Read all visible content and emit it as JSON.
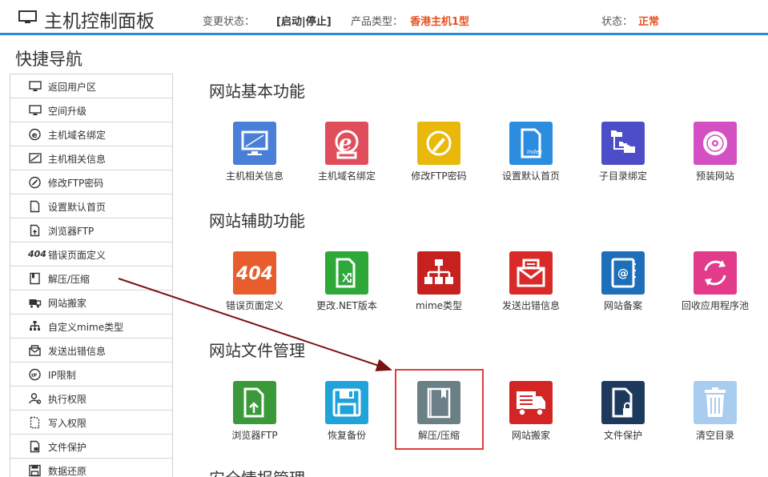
{
  "header": {
    "title": "主机控制面板",
    "change_status_label": "变更状态：",
    "change_status_value": "[启动|停止]",
    "product_type_label": "产品类型：",
    "product_type_value": "香港主机1型",
    "status_label": "状态：",
    "status_value": "正常",
    "colors": {
      "accent": "#2d8bd3",
      "highlight": "#e8501e"
    }
  },
  "sidebar": {
    "title": "快捷导航",
    "items": [
      {
        "label": "返回用户区",
        "icon": "monitor-icon"
      },
      {
        "label": "空间升级",
        "icon": "monitor-icon"
      },
      {
        "label": "主机域名绑定",
        "icon": "domain-e-icon"
      },
      {
        "label": "主机相关信息",
        "icon": "screen-info-icon"
      },
      {
        "label": "修改FTP密码",
        "icon": "pencil-circle-icon"
      },
      {
        "label": "设置默认首页",
        "icon": "page-index-icon"
      },
      {
        "label": "浏览器FTP",
        "icon": "file-upload-icon"
      },
      {
        "label": "错误页面定义",
        "icon": "error-404-icon",
        "prefix": "404"
      },
      {
        "label": "解压/压缩",
        "icon": "book-icon"
      },
      {
        "label": "网站搬家",
        "icon": "truck-icon"
      },
      {
        "label": "自定义mime类型",
        "icon": "sitemap-icon"
      },
      {
        "label": "发送出错信息",
        "icon": "mail-icon"
      },
      {
        "label": "IP限制",
        "icon": "ip-block-icon"
      },
      {
        "label": "执行权限",
        "icon": "user-gear-icon"
      },
      {
        "label": "写入权限",
        "icon": "file-dashed-icon"
      },
      {
        "label": "文件保护",
        "icon": "file-lock-icon"
      },
      {
        "label": "数据还原",
        "icon": "save-disk-icon"
      }
    ]
  },
  "sections": [
    {
      "title": "网站基本功能",
      "tiles": [
        {
          "label": "主机相关信息",
          "icon": "monitor-icon",
          "color": "#4a7fd8"
        },
        {
          "label": "主机域名绑定",
          "icon": "domain-e-icon",
          "color": "#e04e5c"
        },
        {
          "label": "修改FTP密码",
          "icon": "pencil-circle-icon",
          "color": "#e8b90a"
        },
        {
          "label": "设置默认首页",
          "icon": "page-index-icon",
          "color": "#2c8de0"
        },
        {
          "label": "子目录绑定",
          "icon": "folder-tree-icon",
          "color": "#4d4dc8"
        },
        {
          "label": "预装网站",
          "icon": "disc-icon",
          "color": "#d44fc2"
        }
      ]
    },
    {
      "title": "网站辅助功能",
      "tiles": [
        {
          "label": "错误页面定义",
          "icon": "error-404-icon",
          "color": "#e85d2c",
          "text": "404"
        },
        {
          "label": "更改.NET版本",
          "icon": "file-shuffle-icon",
          "color": "#2fa83a"
        },
        {
          "label": "mime类型",
          "icon": "sitemap-icon",
          "color": "#c6211f"
        },
        {
          "label": "发送出错信息",
          "icon": "mail-icon",
          "color": "#d92929"
        },
        {
          "label": "网站备案",
          "icon": "address-book-icon",
          "color": "#1c6fb8"
        },
        {
          "label": "回收应用程序池",
          "icon": "recycle-arrows-icon",
          "color": "#e33b8b"
        }
      ]
    },
    {
      "title": "网站文件管理",
      "tiles": [
        {
          "label": "浏览器FTP",
          "icon": "file-upload-icon",
          "color": "#3a9a3a"
        },
        {
          "label": "恢复备份",
          "icon": "save-disk-icon",
          "color": "#1fa3d9"
        },
        {
          "label": "解压/压缩",
          "icon": "book-icon",
          "color": "#6b7f86"
        },
        {
          "label": "网站搬家",
          "icon": "truck-icon",
          "color": "#d42525"
        },
        {
          "label": "文件保护",
          "icon": "file-lock-icon",
          "color": "#1d3a5c"
        },
        {
          "label": "清空目录",
          "icon": "trash-icon",
          "color": "#a9cdef"
        }
      ]
    },
    {
      "title": "安全情报管理",
      "tiles": []
    }
  ]
}
